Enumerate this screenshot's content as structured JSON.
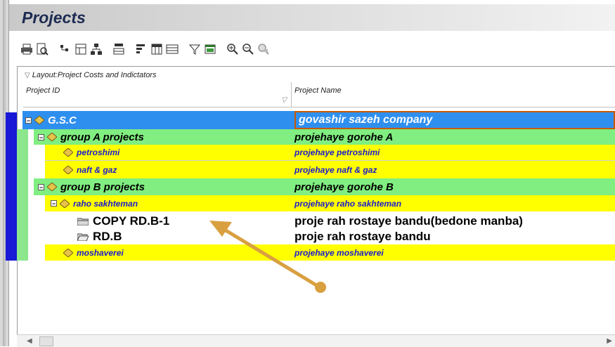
{
  "window": {
    "title": "Projects"
  },
  "toolbar": {
    "icons": [
      "print-icon",
      "print-preview-icon",
      "group-by-icon",
      "organize-icon",
      "wbs-icon",
      "columns-icon",
      "bars-icon",
      "table-icon",
      "spreadsheet-icon",
      "filter-icon",
      "layout-icon",
      "zoom-in-icon",
      "zoom-out-icon",
      "zoom-fit-icon"
    ]
  },
  "layout": {
    "label": "Layout:Project Costs and Indictators",
    "columns": [
      "Project ID",
      "Project Name"
    ]
  },
  "rows": [
    {
      "id": "G.S.C",
      "name": "govashir sazeh company"
    },
    {
      "id": "group A projects",
      "name": "projehaye gorohe A"
    },
    {
      "id": "petroshimi",
      "name": "projehaye petroshimi"
    },
    {
      "id": "naft & gaz",
      "name": "projehaye naft & gaz"
    },
    {
      "id": "group B projects",
      "name": "projehaye gorohe B"
    },
    {
      "id": "raho sakhteman",
      "name": "projehaye raho sakhteman"
    },
    {
      "id": "COPY RD.B-1",
      "name": "proje rah rostaye bandu(bedone manba)"
    },
    {
      "id": "RD.B",
      "name": "proje rah rostaye bandu"
    },
    {
      "id": "moshaverei",
      "name": "projehaye moshaverei"
    }
  ],
  "colors": {
    "eps_root": "#2f8fef",
    "eps_group": "#80ee80",
    "eps_leaf": "#ffff00",
    "stripe": "#1818d6",
    "annotation_arrow": "#d9a040"
  }
}
